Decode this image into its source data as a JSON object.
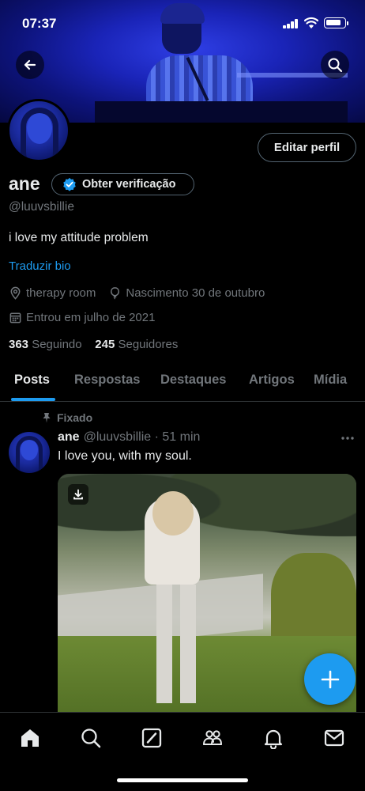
{
  "status_bar": {
    "time": "07:37"
  },
  "profile": {
    "name": "ane",
    "verify_label": "Obter verificação",
    "handle": "@luuvsbillie",
    "bio": "i love my attitude problem",
    "translate_label": "Traduzir bio",
    "location": "therapy room",
    "birthday": "Nascimento 30 de outubro",
    "joined": "Entrou em julho de 2021",
    "following_count": "363",
    "following_label": "Seguindo",
    "followers_count": "245",
    "followers_label": "Seguidores",
    "edit_label": "Editar perfil"
  },
  "tabs": [
    {
      "label": "Posts",
      "active": true
    },
    {
      "label": "Respostas",
      "active": false
    },
    {
      "label": "Destaques",
      "active": false
    },
    {
      "label": "Artigos",
      "active": false
    },
    {
      "label": "Mídia",
      "active": false
    }
  ],
  "post": {
    "pinned_label": "Fixado",
    "author_name": "ane",
    "author_handle_time": "@luuvsbillie · 51 min",
    "text": "I love you, with my soul."
  },
  "icons": {
    "back": "arrow-left-icon",
    "search": "search-icon",
    "verified": "verified-badge-icon",
    "location": "location-pin-icon",
    "birthday": "balloon-icon",
    "calendar": "calendar-icon",
    "pin": "pin-icon",
    "more": "more-icon",
    "download": "download-icon",
    "compose": "plus-icon",
    "nav": [
      "home-icon",
      "search-icon",
      "grok-icon",
      "communities-icon",
      "notifications-icon",
      "messages-icon"
    ]
  },
  "colors": {
    "accent": "#1d9bf0",
    "background": "#000000",
    "muted": "#71767b",
    "text": "#e7e9ea"
  }
}
